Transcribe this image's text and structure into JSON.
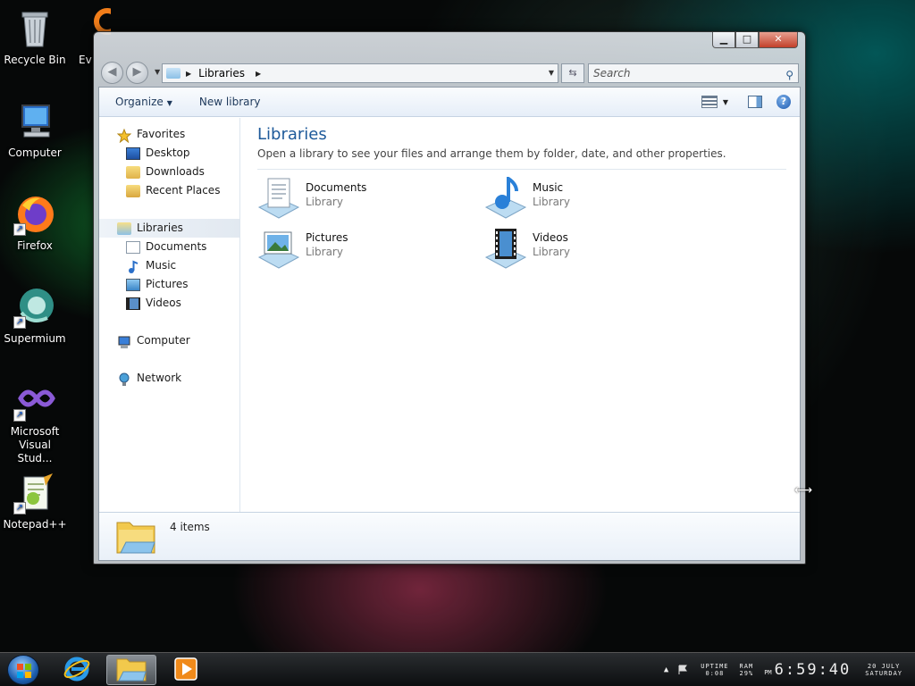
{
  "desktop": {
    "icons": [
      {
        "label": "Recycle Bin"
      },
      {
        "label": "Computer"
      },
      {
        "label": "Firefox"
      },
      {
        "label": "Supermium"
      },
      {
        "label": "Microsoft Visual Stud..."
      },
      {
        "label": "Notepad++"
      }
    ],
    "partial_icon_label": "Ev"
  },
  "window": {
    "address": {
      "crumb": "Libraries"
    },
    "search": {
      "placeholder": "Search"
    },
    "commandbar": {
      "organize": "Organize",
      "new_library": "New library"
    },
    "nav": {
      "favorites": "Favorites",
      "desktop": "Desktop",
      "downloads": "Downloads",
      "recent_places": "Recent Places",
      "libraries": "Libraries",
      "documents": "Documents",
      "music": "Music",
      "pictures": "Pictures",
      "videos": "Videos",
      "computer": "Computer",
      "network": "Network"
    },
    "content": {
      "title": "Libraries",
      "description": "Open a library to see your files and arrange them by folder, date, and other properties.",
      "libraries": [
        {
          "name": "Documents",
          "type": "Library",
          "icon": "documents-library-icon"
        },
        {
          "name": "Music",
          "type": "Library",
          "icon": "music-library-icon"
        },
        {
          "name": "Pictures",
          "type": "Library",
          "icon": "pictures-library-icon"
        },
        {
          "name": "Videos",
          "type": "Library",
          "icon": "videos-library-icon"
        }
      ]
    },
    "details": {
      "item_count": "4 items"
    }
  },
  "taskbar": {
    "tray": {
      "uptime_label": "UPTIME",
      "uptime_value": "0:08",
      "ram_label": "RAM",
      "ram_value": "29%",
      "ampm": "PM",
      "time": "6:59:40",
      "date": "20 JULY",
      "weekday": "SATURDAY"
    }
  },
  "colors": {
    "title_blue": "#1e5a9a",
    "command_text": "#1e395b",
    "close_red": "#c2402a"
  }
}
